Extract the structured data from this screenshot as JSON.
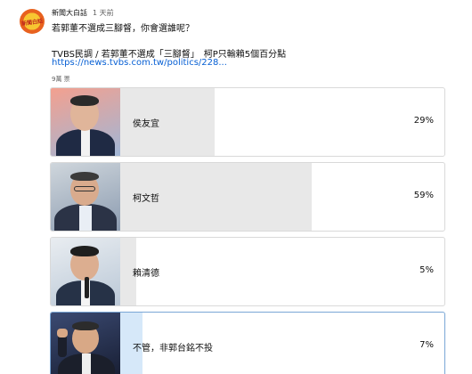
{
  "channel": {
    "name": "新聞大白話",
    "time": "1 天前",
    "avatar_text": "新聞大白話"
  },
  "post": {
    "question": "若郭董不選成三腳督，你會選誰呢？",
    "body": "TVBS民調 / 若郭董不選成「三腳督」　柯P只輸賴5個百分點",
    "link": "https://news.tvbs.com.tw/politics/228...",
    "votes": "9萬 票"
  },
  "options": [
    {
      "label": "侯友宜",
      "percent": "29%",
      "value": 0.29,
      "photo_icon": "portrait-man-suit-icon"
    },
    {
      "label": "柯文哲",
      "percent": "59%",
      "value": 0.59,
      "photo_icon": "portrait-man-glasses-icon"
    },
    {
      "label": "賴清德",
      "percent": "5%",
      "value": 0.05,
      "photo_icon": "portrait-man-microphone-icon"
    },
    {
      "label": "不管，非郭台銘不投",
      "percent": "7%",
      "value": 0.07,
      "photo_icon": "portrait-man-raised-fist-icon",
      "selected": true
    }
  ],
  "colors": {
    "link": "#065fd4",
    "bar_fill": "#e8e8e8",
    "selected_fill": "#d6e8f9",
    "selected_border": "#7aa7d6"
  }
}
